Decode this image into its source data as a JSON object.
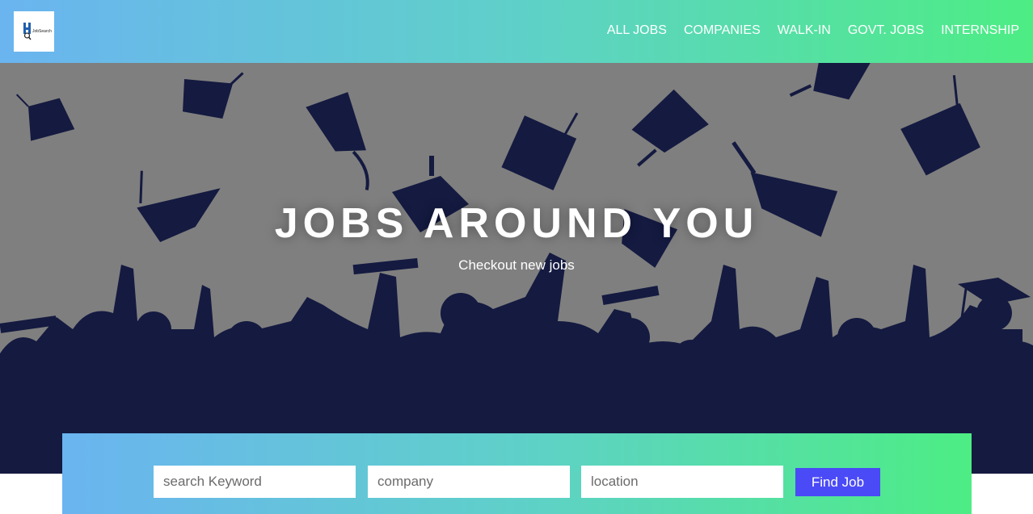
{
  "navbar": {
    "logo_icon": "jobsearch-logo",
    "logo_text": "JobSearch",
    "links": [
      "ALL JOBS",
      "COMPANIES",
      "WALK-IN",
      "GOVT. JOBS",
      "INTERNSHIP"
    ]
  },
  "hero": {
    "title": "JOBS AROUND YOU",
    "subtitle": "Checkout new jobs",
    "background_illustration": "graduates-throwing-caps"
  },
  "search": {
    "keyword_placeholder": "search Keyword",
    "company_placeholder": "company",
    "location_placeholder": "location",
    "button_label": "Find Job"
  },
  "colors": {
    "gradient_start": "#6ab4f0",
    "gradient_end": "#4ded84",
    "hero_bg": "#7f7f7f",
    "silhouette": "#141a40",
    "button": "#4a4af7"
  }
}
